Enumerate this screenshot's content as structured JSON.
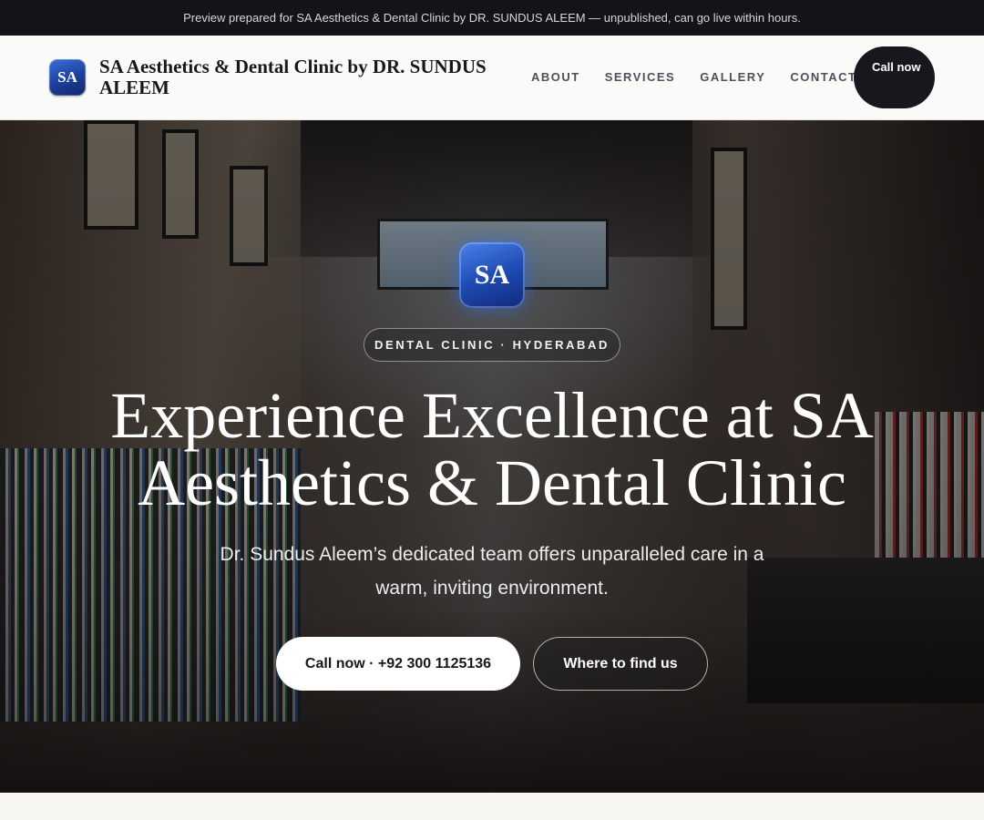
{
  "preview_banner": {
    "text": "Preview prepared for SA Aesthetics & Dental Clinic by DR. SUNDUS ALEEM — unpublished, can go live within hours."
  },
  "header": {
    "logo_text": "SA",
    "brand_name": "SA Aesthetics & Dental Clinic by DR. SUNDUS ALEEM",
    "nav": [
      {
        "label": "ABOUT"
      },
      {
        "label": "SERVICES"
      },
      {
        "label": "GALLERY"
      },
      {
        "label": "CONTACT"
      }
    ],
    "cta_label": "Call now"
  },
  "hero": {
    "logo_text": "SA",
    "tag": "DENTAL CLINIC · HYDERABAD",
    "title": "Experience Excellence at SA Aesthetics & Dental Clinic",
    "subtitle": "Dr. Sundus Aleem’s dedicated team offers unparalleled care in a warm, inviting environment.",
    "primary_button": "Call now · +92 300 1125136",
    "secondary_button": "Where to find us"
  },
  "colors": {
    "banner_bg": "#12141a",
    "accent_blue": "#1f4cb4",
    "dark_button": "#16181e"
  }
}
